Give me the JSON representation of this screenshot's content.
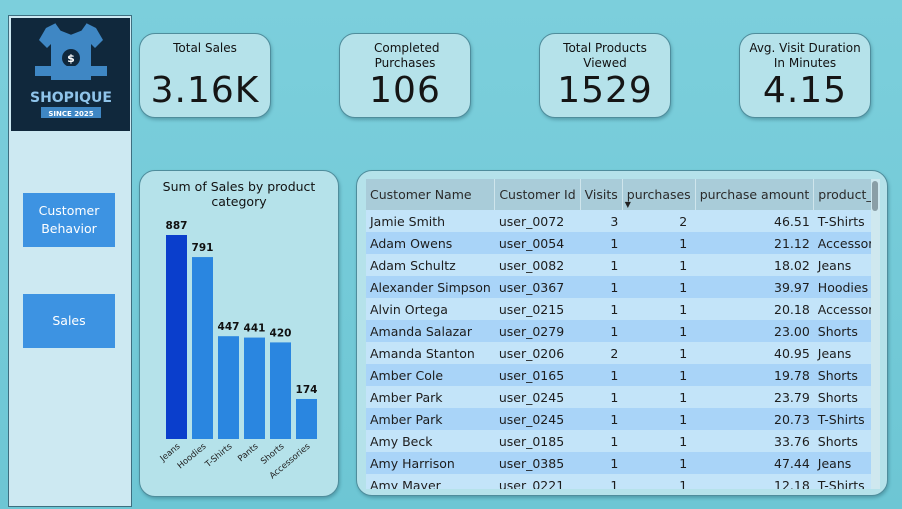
{
  "logo": {
    "brand": "SHOPIQUE",
    "tagline": "SINCE 2025",
    "badge": "$"
  },
  "nav": [
    {
      "label": "Customer Behavior"
    },
    {
      "label": "Sales"
    }
  ],
  "kpis": [
    {
      "title": "Total Sales",
      "value": "3.16K"
    },
    {
      "title": "Completed Purchases",
      "value": "106"
    },
    {
      "title": "Total Products Viewed",
      "value": "1529"
    },
    {
      "title": "Avg. Visit Duration In Minutes",
      "value": "4.15"
    }
  ],
  "colors": {
    "background": "#6dc6d4",
    "card": "#b5e2ea",
    "bar_highlight": "#0a3ecc",
    "bar": "#2a86e0",
    "nav_button": "#3d93e2",
    "row_odd": "#c3e4f9",
    "row_even": "#a9d4f8"
  },
  "chart_data": {
    "type": "bar",
    "title": "Sum of Sales by product category",
    "categories": [
      "Jeans",
      "Hoodies",
      "T-Shirts",
      "Pants",
      "Shorts",
      "Accessories"
    ],
    "values": [
      887,
      791,
      447,
      441,
      420,
      174
    ],
    "data_labels": [
      "887",
      "791",
      "447",
      "441",
      "420",
      "174"
    ],
    "ylim": [
      0,
      887
    ],
    "grid": false
  },
  "table": {
    "columns": [
      "Customer Name",
      "Customer Id",
      "Visits",
      "purchases",
      "purchase amount",
      "product_category"
    ],
    "sorted_column": "purchases",
    "rows": [
      [
        "Jamie Smith",
        "user_0072",
        "3",
        "2",
        "46.51",
        "T-Shirts"
      ],
      [
        "Adam Owens",
        "user_0054",
        "1",
        "1",
        "21.12",
        "Accessories"
      ],
      [
        "Adam Schultz",
        "user_0082",
        "1",
        "1",
        "18.02",
        "Jeans"
      ],
      [
        "Alexander Simpson",
        "user_0367",
        "1",
        "1",
        "39.97",
        "Hoodies"
      ],
      [
        "Alvin Ortega",
        "user_0215",
        "1",
        "1",
        "20.18",
        "Accessories"
      ],
      [
        "Amanda Salazar",
        "user_0279",
        "1",
        "1",
        "23.00",
        "Shorts"
      ],
      [
        "Amanda Stanton",
        "user_0206",
        "2",
        "1",
        "40.95",
        "Jeans"
      ],
      [
        "Amber Cole",
        "user_0165",
        "1",
        "1",
        "19.78",
        "Shorts"
      ],
      [
        "Amber Park",
        "user_0245",
        "1",
        "1",
        "23.79",
        "Shorts"
      ],
      [
        "Amber Park",
        "user_0245",
        "1",
        "1",
        "20.73",
        "T-Shirts"
      ],
      [
        "Amy Beck",
        "user_0185",
        "1",
        "1",
        "33.76",
        "Shorts"
      ],
      [
        "Amy Harrison",
        "user_0385",
        "1",
        "1",
        "47.44",
        "Jeans"
      ],
      [
        "Amy Mayer",
        "user_0221",
        "1",
        "1",
        "12.18",
        "T-Shirts"
      ]
    ]
  }
}
